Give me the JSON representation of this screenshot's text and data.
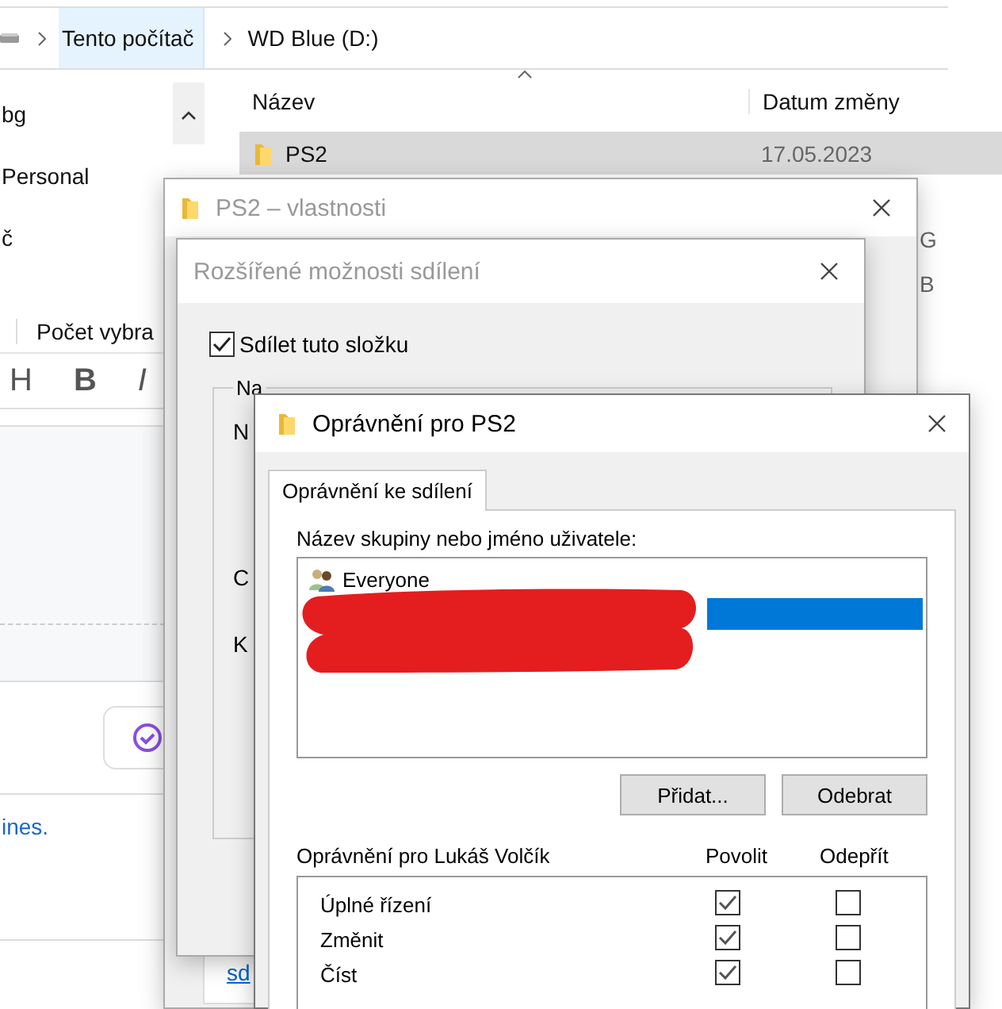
{
  "explorer": {
    "breadcrumb": [
      {
        "label": "Tento počítač",
        "selected": true
      },
      {
        "label": "WD Blue (D:)",
        "selected": false
      }
    ],
    "nav_items": [
      "bg",
      "Personal",
      "č"
    ],
    "columns": [
      "Název",
      "Datum změny"
    ],
    "rows": [
      {
        "name": "PS2",
        "date": "17.05.2023",
        "selected": true
      }
    ],
    "column_3_fragments": [
      "G",
      "B"
    ],
    "status": "Počet vybra"
  },
  "editor": {
    "toolbar": [
      "H",
      "B",
      "I"
    ],
    "link_text": "ines."
  },
  "properties_window": {
    "title": "PS2 – vlastnosti",
    "active": false,
    "link_text": "sd"
  },
  "advanced_sharing": {
    "title": "Rozšířené možnosti sdílení",
    "active": false,
    "share": {
      "label": "Sdílet tuto složku",
      "checked": true
    },
    "group_label": "Na",
    "fragments": [
      "N",
      "C",
      "K"
    ]
  },
  "permissions": {
    "title": "Oprávnění pro PS2",
    "active": true,
    "tabs": [
      {
        "label": "Oprávnění ke sdílení",
        "selected": true
      }
    ],
    "list_label": "Název skupiny nebo jméno uživatele:",
    "principals": [
      {
        "kind": "group",
        "name": "Everyone",
        "selected": false
      },
      {
        "kind": "redacted",
        "selected": true
      }
    ],
    "buttons": [
      "Přidat...",
      "Odebrat"
    ],
    "permissions_label": "Oprávnění pro Lukáš Volčík",
    "columns": [
      "Povolit",
      "Odepřít"
    ],
    "rows": [
      {
        "name": "Úplné řízení",
        "allow": true,
        "deny": false
      },
      {
        "name": "Změnit",
        "allow": true,
        "deny": false
      },
      {
        "name": "Číst",
        "allow": true,
        "deny": false
      }
    ]
  }
}
